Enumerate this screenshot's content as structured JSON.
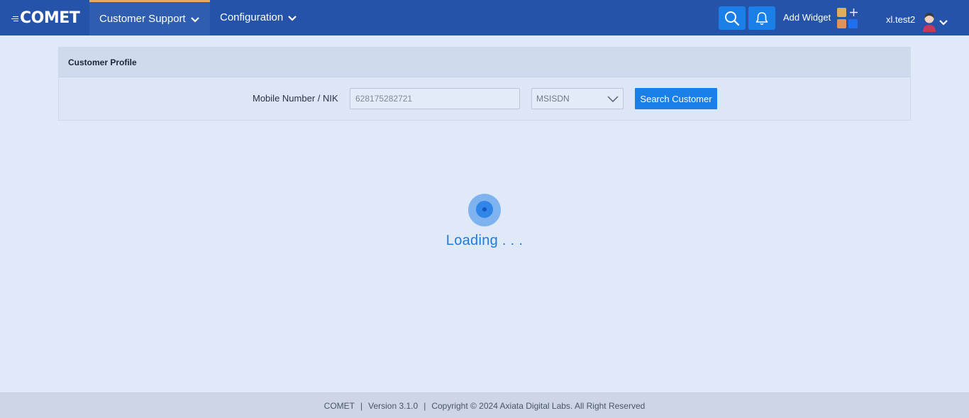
{
  "header": {
    "logo_text": "COMET",
    "nav": [
      {
        "label": "Customer Support",
        "active": true
      },
      {
        "label": "Configuration",
        "active": false
      }
    ],
    "search_icon": "search-icon",
    "notification_icon": "bell-icon",
    "add_widget_label": "Add Widget",
    "username": "xl.test2",
    "colors": {
      "bar": "#2553a9",
      "active_indicator": "#e0ad5c",
      "icon_button": "#1a7fe6"
    }
  },
  "profile": {
    "title": "Customer Profile",
    "field_label": "Mobile Number / NIK",
    "input_placeholder": "628175282721",
    "select_value": "MSISDN",
    "search_button_label": "Search Customer"
  },
  "loader": {
    "text": "Loading . . ."
  },
  "footer": {
    "app": "COMET",
    "version": "Version 3.1.0",
    "copyright": "Copyright © 2024 Axiata Digital Labs. All Right Reserved"
  }
}
